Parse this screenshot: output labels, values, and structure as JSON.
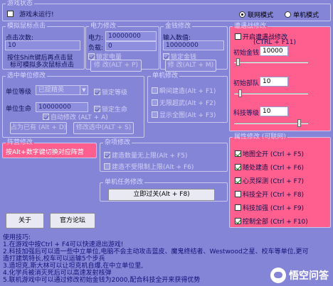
{
  "status": {
    "legend": "游戏状态",
    "game_status": "游戏未运行!",
    "modes": [
      {
        "label": "联网模式",
        "selected": true
      },
      {
        "label": "单机模式",
        "selected": false
      }
    ]
  },
  "mouse_click": {
    "legend": "模拟鼠标点击",
    "count_label": "点击次数:",
    "count_value": "10",
    "hint_line1": "按住Shift键后再点击鼠",
    "hint_line2": "标可模拟多次鼠标点击"
  },
  "power": {
    "legend": "电力修改",
    "power_label": "电力:",
    "power_value": "10000000",
    "load_label": "负载:",
    "load_value": "0",
    "lock_label": "锁定电量",
    "modify_button": "修 改(ALT + P)"
  },
  "money": {
    "legend": "金钱修改",
    "input_label": "输入数值:",
    "input_value": "10000000",
    "lock_label": "锁定金钱",
    "modify_button": "修 改(ALT + M)"
  },
  "encounter": {
    "legend": "遭遇战修改",
    "enable_label": "开启遭遇战修改",
    "enable_hotkey": "(CTRL + F11)",
    "initial_money_label": "初始金钱",
    "initial_money_value": "10000",
    "initial_troops_label": "初始部队",
    "initial_troops_value": "10",
    "tech_level_label": "科技等级",
    "tech_level_value": "10",
    "sliders": [
      {
        "position": 0.03
      },
      {
        "position": 0.06
      },
      {
        "position": 0.9
      }
    ]
  },
  "unit": {
    "legend": "选中单位修改",
    "level_label": "单位等级",
    "level_value": "已提精英",
    "lock_level_label": "锁定等级",
    "life_label": "单位生命",
    "life_value": "10000000",
    "lock_life_label": "锁定生命",
    "auto_modify_label": "自动修改 (ALT + A)",
    "take_button": "占为已有 (Alt + D)",
    "modify_button": "修改选中(ALT + S)"
  },
  "single": {
    "legend": "单机修改",
    "items": [
      {
        "label": "瞬间建造(Alt + F1)"
      },
      {
        "label": "无限超武(Alt + F2)"
      },
      {
        "label": "显示全图(Alt + F3)"
      }
    ]
  },
  "faction": {
    "legend": "阵营修改",
    "hint": "按Alt+数字键切换对应阵营"
  },
  "misc": {
    "legend": "杂项修改",
    "items": [
      {
        "label": "建造数量无上限(Alt + F5)"
      },
      {
        "label": "建造不受限制上限(Alt + F6)"
      }
    ]
  },
  "mission": {
    "legend": "单机任务修改",
    "button": "立即过关(Alt + F8)"
  },
  "attributes": {
    "legend": "属性修改 (可联网)",
    "items": [
      {
        "label": "地图全开 (Ctrl + F5)",
        "checked": true
      },
      {
        "label": "随处建造 (Ctrl + F6)",
        "checked": true
      },
      {
        "label": "心灵探测 (Ctrl + F7)",
        "checked": true
      },
      {
        "label": "科技全开 (Ctrl + F8)",
        "checked": false
      },
      {
        "label": "科技加强 (Ctrl + F9)",
        "checked": false
      },
      {
        "label": "控制全部 (Ctrl + F10)",
        "checked": true
      }
    ]
  },
  "bottom_buttons": {
    "about": "关于",
    "forum": "官方论坛"
  },
  "tips": {
    "title": "使用技巧:",
    "lines": [
      "1.在游戏中按Ctrl + F4可以快速退出游戏!",
      "2.科技加强后可以造一些中立单位,电脑不会主动攻击蓝皮、魔鬼终结者、Westwood之星、校车等单位,更可",
      "造打建筑特长,校车可以运输5个步兵",
      "3.造坦克,斯大林可以让坦克机自爆,在中立单位里,",
      "4.化学兵被消灭死后可以高速发射核弹",
      "5.联机游戏中可以通过修改初始金钱为2000,配合科技全开来获得优势"
    ]
  },
  "watermark": {
    "text": "悟空问答"
  }
}
